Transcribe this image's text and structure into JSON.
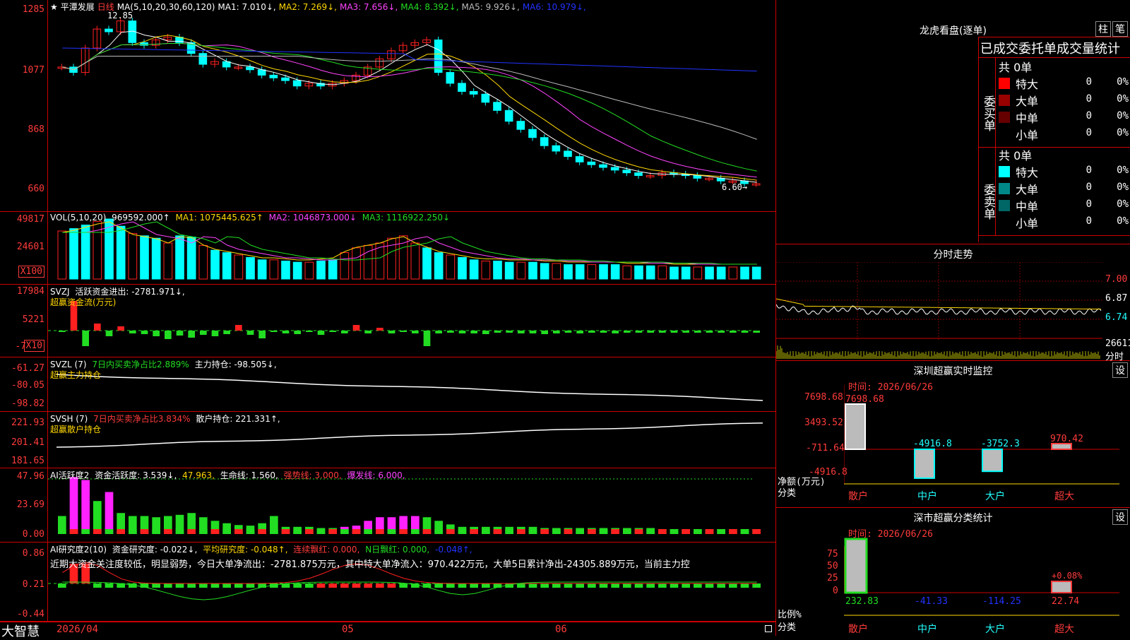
{
  "kline": {
    "name": "平潭发展",
    "period": "日线",
    "ma_header": "MA(5,10,20,30,60,120)",
    "mas": [
      {
        "label": "MA1:",
        "value": "7.010↓",
        "color": "#ffffff"
      },
      {
        "label": "MA2:",
        "value": "7.269↓",
        "color": "#ffd700"
      },
      {
        "label": "MA3:",
        "value": "7.656↓",
        "color": "#ff44ff"
      },
      {
        "label": "MA4:",
        "value": "8.392↓",
        "color": "#22dd22"
      },
      {
        "label": "MA5:",
        "value": "9.926↓",
        "color": "#bbbbbb"
      },
      {
        "label": "MA6:",
        "value": "10.979↓",
        "color": "#2233ff"
      }
    ],
    "high_label": "12.85",
    "low_label": "6.60→",
    "yticks": [
      "1285",
      "1077",
      "868",
      "660"
    ]
  },
  "vol": {
    "header": "VOL(5,10,20)",
    "value": "969592.000↑",
    "ma1": "MA1: 1075445.625↑",
    "ma2": "MA2: 1046873.000↓",
    "ma3": "MA3: 1116922.250↓",
    "yticks": [
      "49817",
      "24601"
    ],
    "unit": "X100"
  },
  "svzj": {
    "header": "SVZJ",
    "label": "活跃资金进出: -2781.971↓,",
    "sub": "超赢资金流(万元)",
    "yticks": [
      "17984",
      "5221",
      "-7"
    ],
    "unit": "X10"
  },
  "svzl": {
    "header": "SVZL (7)",
    "ratio": "7日内买卖净占比2.889%",
    "label": "主力持仓: -98.505↓,",
    "sub": "超赢主力持仓",
    "yticks": [
      "-61.27",
      "-80.05",
      "-98.82"
    ]
  },
  "svsh": {
    "header": "SVSH (7)",
    "ratio": "7日内买卖净占比3.834%",
    "label": "散户持仓: 221.331↑,",
    "sub": "超赢散户持仓",
    "yticks": [
      "221.93",
      "201.41",
      "181.65"
    ]
  },
  "ai1": {
    "header": "AI活跃度2",
    "a": "资金活跃度: 3.539↓,",
    "b": "47.963,",
    "c": "生命线: 1.560,",
    "d": "强势线: 3.000,",
    "e": "爆发线: 6.000,",
    "yticks": [
      "47.96",
      "23.69",
      "0.00"
    ]
  },
  "ai2": {
    "header": "AI研究度2(10)",
    "a": "资金研究度: -0.022↓,",
    "b": "平均研究度: -0.048↑,",
    "c": "连续飘红: 0.000,",
    "d": "N日飘红: 0.000,",
    "e": "-0.048↑,",
    "text": "近期大资金关注度较低，明显弱势，今日大单净流出：-2781.875万元，其中特大单净流入：970.422万元，大单5日累计净出-24305.889万元，当前主力控",
    "yticks": [
      "0.86",
      "0.21",
      "-0.44"
    ]
  },
  "statusbar": {
    "logo": "大智慧",
    "dates": [
      "2026/04",
      "05",
      "06"
    ]
  },
  "lhb": {
    "title": "龙虎看盘(逐单)",
    "btn1": "柱",
    "btn2": "笔",
    "head": "已成交委托单成交量统计",
    "buy_side": "委买单",
    "sell_side": "委卖单",
    "buy_total": "共 0单",
    "sell_total": "共 0单",
    "rows": [
      {
        "name": "特大",
        "v": "0",
        "p": "0%"
      },
      {
        "name": "大单",
        "v": "0",
        "p": "0%"
      },
      {
        "name": "中单",
        "v": "0",
        "p": "0%"
      },
      {
        "name": "小单",
        "v": "0",
        "p": "0%"
      }
    ],
    "buy_colors": [
      "#ff0000",
      "#990000",
      "#660000",
      "#000000"
    ],
    "sell_colors": [
      "#00ffff",
      "#008888",
      "#006666",
      "#000000"
    ]
  },
  "fenshi": {
    "title": "分时走势",
    "yticks": [
      "7.00",
      "6.87",
      "6.74"
    ],
    "vol": "26611",
    "vol_label": "分时"
  },
  "monitor": {
    "title": "深圳超赢实时监控",
    "btn": "设",
    "date": "时间: 2026/06/26",
    "yticks": [
      "7698.68",
      "3493.52",
      "-711.64",
      "-4916.8"
    ],
    "ylabel": "净额(万元)",
    "xlabel": "分类",
    "cats": [
      "散户",
      "中户",
      "大户",
      "超大"
    ],
    "values": [
      7698.68,
      -4916.8,
      -3752.3,
      970.42
    ],
    "value_labels": [
      "7698.68",
      "-4916.8",
      "-3752.3",
      "970.42"
    ]
  },
  "classify": {
    "title": "深市超赢分类统计",
    "btn": "设",
    "date": "时间: 2026/06/26",
    "yticks": [
      "75",
      "50",
      "25",
      "0"
    ],
    "ylabel": "比例%",
    "xlabel": "分类",
    "cats": [
      "散户",
      "中户",
      "大户",
      "超大"
    ],
    "bottom_values": [
      "232.83",
      "-41.33",
      "-114.25",
      "22.74"
    ],
    "top_label": "+0.08%"
  },
  "chart_data": [
    {
      "type": "line",
      "title": "分时走势",
      "y_ticks": [
        7.0,
        6.87,
        6.74
      ]
    },
    {
      "type": "bar",
      "title": "深圳超赢实时监控",
      "categories": [
        "散户",
        "中户",
        "大户",
        "超大"
      ],
      "values": [
        7698.68,
        -4916.8,
        -3752.3,
        970.42
      ],
      "ylabel": "净额(万元)",
      "xlabel": "分类"
    },
    {
      "type": "bar",
      "title": "深市超赢分类统计",
      "categories": [
        "散户",
        "中户",
        "大户",
        "超大"
      ],
      "values": [
        232.83,
        -41.33,
        -114.25,
        22.74
      ],
      "ylabel": "比例%",
      "xlabel": "分类",
      "ylim": [
        0,
        75
      ]
    }
  ]
}
